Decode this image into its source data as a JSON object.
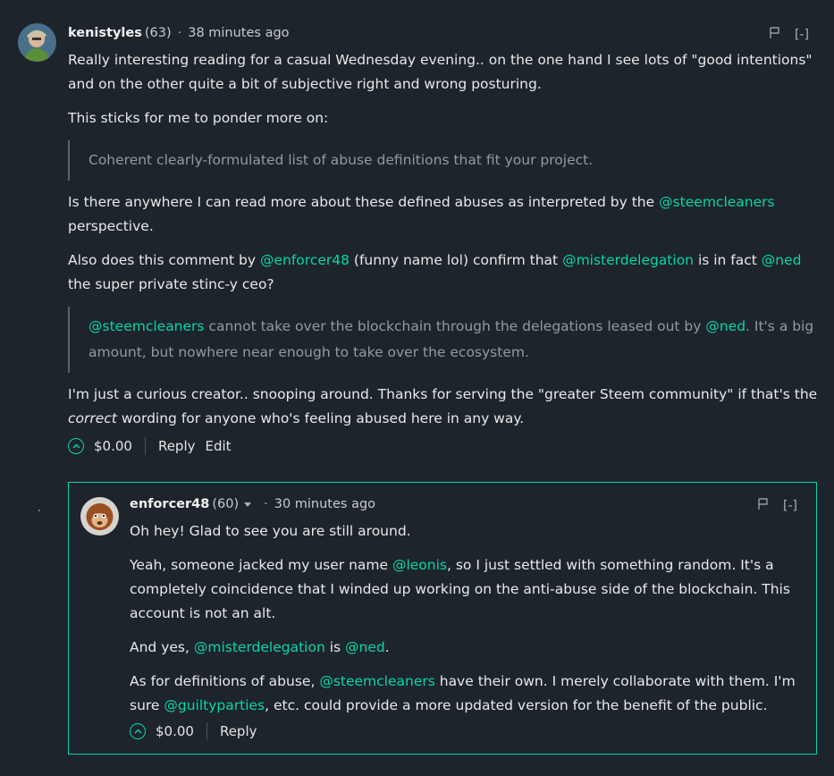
{
  "comment1": {
    "author": "kenistyles",
    "reputation": "(63)",
    "separator": "·",
    "time": "38 minutes ago",
    "collapse": "[-]",
    "p1": "Really interesting reading for a casual Wednesday evening.. on the one hand I see lots of \"good intentions\" and on the other quite a bit of subjective right and wrong posturing.",
    "p2": "This sticks for me to ponder more on:",
    "quote1": "Coherent clearly-formulated list of abuse definitions that fit your project.",
    "p3_a": "Is there anywhere I can read more about these defined abuses as interpreted by the ",
    "p3_mention": "@steemcleaners",
    "p3_b": " perspective.",
    "p4_a": "Also does this comment by ",
    "p4_m1": "@enforcer48",
    "p4_b": " (funny name lol) confirm that ",
    "p4_m2": "@misterdelegation",
    "p4_c": " is in fact ",
    "p4_m3": "@ned",
    "p4_d": " the super private stinc-y ceo?",
    "quote2_m1": "@steemcleaners",
    "quote2_a": " cannot take over the blockchain through the delegations leased out by ",
    "quote2_m2": "@ned",
    "quote2_b": ". It's a big amount, but nowhere near enough to take over the ecosystem.",
    "p5_a": "I'm just a curious creator.. snooping around. Thanks for serving the \"greater Steem community\" if that's the ",
    "p5_em": "correct",
    "p5_b": " wording for anyone who's feeling abused here in any way.",
    "payout": "$0.00",
    "reply_label": "Reply",
    "edit_label": "Edit"
  },
  "comment2": {
    "author": "enforcer48",
    "reputation": "(60)",
    "separator": "·",
    "time": "30 minutes ago",
    "collapse": "[-]",
    "p1": "Oh hey! Glad to see you are still around.",
    "p2_a": "Yeah, someone jacked my user name ",
    "p2_m": "@leonis",
    "p2_b": ", so I just settled with something random. It's a completely coincidence that I winded up working on the anti-abuse side of the blockchain. This account is not an alt.",
    "p3_a": "And yes, ",
    "p3_m1": "@misterdelegation",
    "p3_b": " is ",
    "p3_m2": "@ned",
    "p3_c": ".",
    "p4_a": "As for definitions of abuse, ",
    "p4_m1": "@steemcleaners",
    "p4_b": " have their own. I merely collaborate with them. I'm sure ",
    "p4_m2": "@guiltyparties",
    "p4_c": ", etc. could provide a more updated version for the benefit of the public.",
    "payout": "$0.00",
    "reply_label": "Reply"
  },
  "colors": {
    "background": "#1d242b",
    "accent": "#06d6a9",
    "text": "#e8e9ea",
    "quote": "#959a9e"
  }
}
